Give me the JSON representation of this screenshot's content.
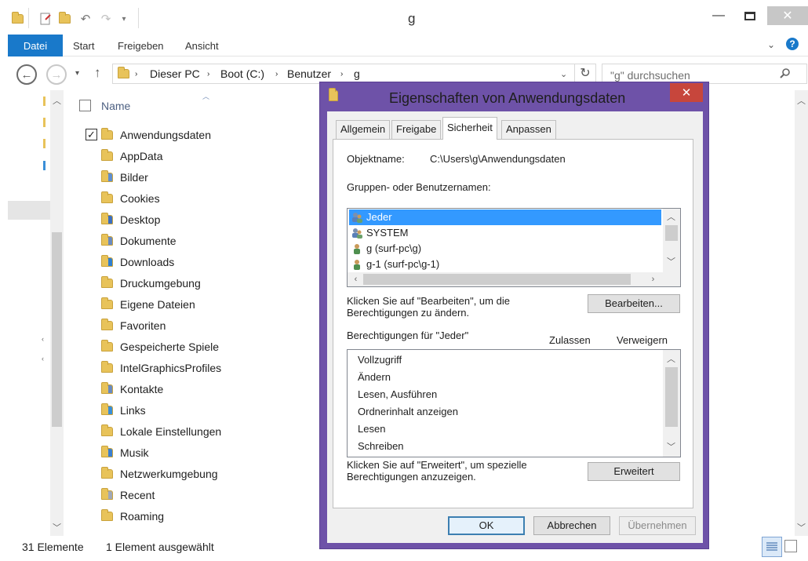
{
  "explorer": {
    "title": "g",
    "ribbon": {
      "file": "Datei",
      "tabs": [
        "Start",
        "Freigeben",
        "Ansicht"
      ]
    },
    "breadcrumbs": [
      "Dieser PC",
      "Boot (C:)",
      "Benutzer",
      "g"
    ],
    "search_placeholder": "\"g\" durchsuchen",
    "column_name": "Name",
    "files": [
      "Anwendungsdaten",
      "AppData",
      "Bilder",
      "Cookies",
      "Desktop",
      "Dokumente",
      "Downloads",
      "Druckumgebung",
      "Eigene Dateien",
      "Favoriten",
      "Gespeicherte Spiele",
      "IntelGraphicsProfiles",
      "Kontakte",
      "Links",
      "Lokale Einstellungen",
      "Musik",
      "Netzwerkumgebung",
      "Recent",
      "Roaming"
    ],
    "status": {
      "count": "31 Elemente",
      "selected": "1 Element ausgewählt"
    }
  },
  "dialog": {
    "title": "Eigenschaften von Anwendungsdaten",
    "tabs": [
      "Allgemein",
      "Freigabe",
      "Sicherheit",
      "Anpassen"
    ],
    "object_label": "Objektname:",
    "object_value": "C:\\Users\\g\\Anwendungsdaten",
    "groups_label": "Gruppen- oder Benutzernamen:",
    "groups": [
      "Jeder",
      "SYSTEM",
      "g (surf-pc\\g)",
      "g-1 (surf-pc\\g-1)"
    ],
    "edit_hint": "Klicken Sie auf \"Bearbeiten\", um die Berechtigungen zu ändern.",
    "edit_button": "Bearbeiten...",
    "perm_label": "Berechtigungen für \"Jeder\"",
    "allow": "Zulassen",
    "deny": "Verweigern",
    "permissions": [
      "Vollzugriff",
      "Ändern",
      "Lesen, Ausführen",
      "Ordnerinhalt anzeigen",
      "Lesen",
      "Schreiben"
    ],
    "advanced_hint": "Klicken Sie auf \"Erweitert\", um spezielle Berechtigungen anzuzeigen.",
    "advanced_button": "Erweitert",
    "ok": "OK",
    "cancel": "Abbrechen",
    "apply": "Übernehmen"
  },
  "colors": {
    "accent": "#1979ca",
    "dialog_frame": "#6e52a8",
    "close": "#c7463c",
    "selection": "#3399ff"
  }
}
